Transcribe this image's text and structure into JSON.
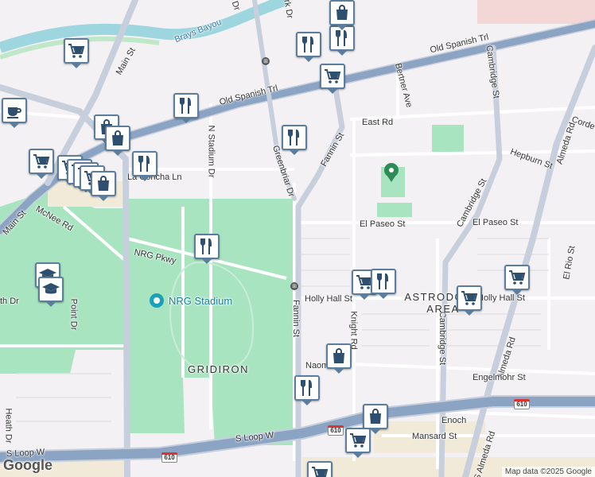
{
  "streets": {
    "brays_bayou": "Brays Bayou",
    "old_spanish_trl_w": "Old Spanish Trl",
    "old_spanish_trl_e": "Old Spanish Trl",
    "main_st": "Main St",
    "main_st_lower": "Main St",
    "cambridge_st_top": "Cambridge St",
    "cambridge_st_mid": "Cambridge St",
    "cambridge_st_low": "Cambridge St",
    "bertner_ave": "Bertner Ave",
    "east_rd": "East Rd",
    "hepburn_st": "Hepburn St",
    "cordell": "Corde",
    "almeda_rd_top": "Almeda Rd",
    "almeda_rd_mid": "Almeda Rd",
    "s_almeda_rd": "S Almeda Rd",
    "el_rio_st": "El Rio St",
    "holly_hall_st_e": "Holly Hall St",
    "fannin_st_top": "Fannin St",
    "fannin_st_mid": "Fannin St",
    "greenbriar_dr": "Greenbriar Dr",
    "n_stadium_dr": "N Stadium Dr",
    "la_concha_ln": "La Concha Ln",
    "mcnee_rd": "McNee Rd",
    "nrg_pkwy": "NRG Pkwy",
    "el_paseo_st_w": "El Paseo St",
    "el_paseo_st_e": "El Paseo St",
    "holly_hall_st": "Holly Hall St",
    "knight_rd": "Knight Rd",
    "naomi": "Naom",
    "engelmohr_st": "Engelmohr St",
    "s_loop_w_w": "S Loop W",
    "s_loop_w_e": "S Loop W",
    "enoch": "Enoch",
    "mansard_st": "Mansard St",
    "th_dr": "th Dr",
    "point_dr": "Point Dr",
    "heath_dr": "Heath Dr",
    "rk_dr": "rk Dr",
    "dr_top": "Dr"
  },
  "areas": {
    "nrg_stadium": "NRG Stadium",
    "gridiron": "GRIDIRON",
    "astrodome_area": "ASTRODOME AREA"
  },
  "shields": {
    "i610_a": "610",
    "i610_b": "610",
    "i610_c": "610"
  },
  "footer": {
    "logo": "Google",
    "attribution": "Map data ©2025 Google"
  },
  "pin_types": [
    "cart",
    "fork-knife",
    "bag",
    "coffee",
    "school"
  ],
  "colors": {
    "pin_border": "#5b7e9e",
    "park": "#a8e4c0",
    "water": "#9ed6e0",
    "highway": "#8ca4c4"
  }
}
